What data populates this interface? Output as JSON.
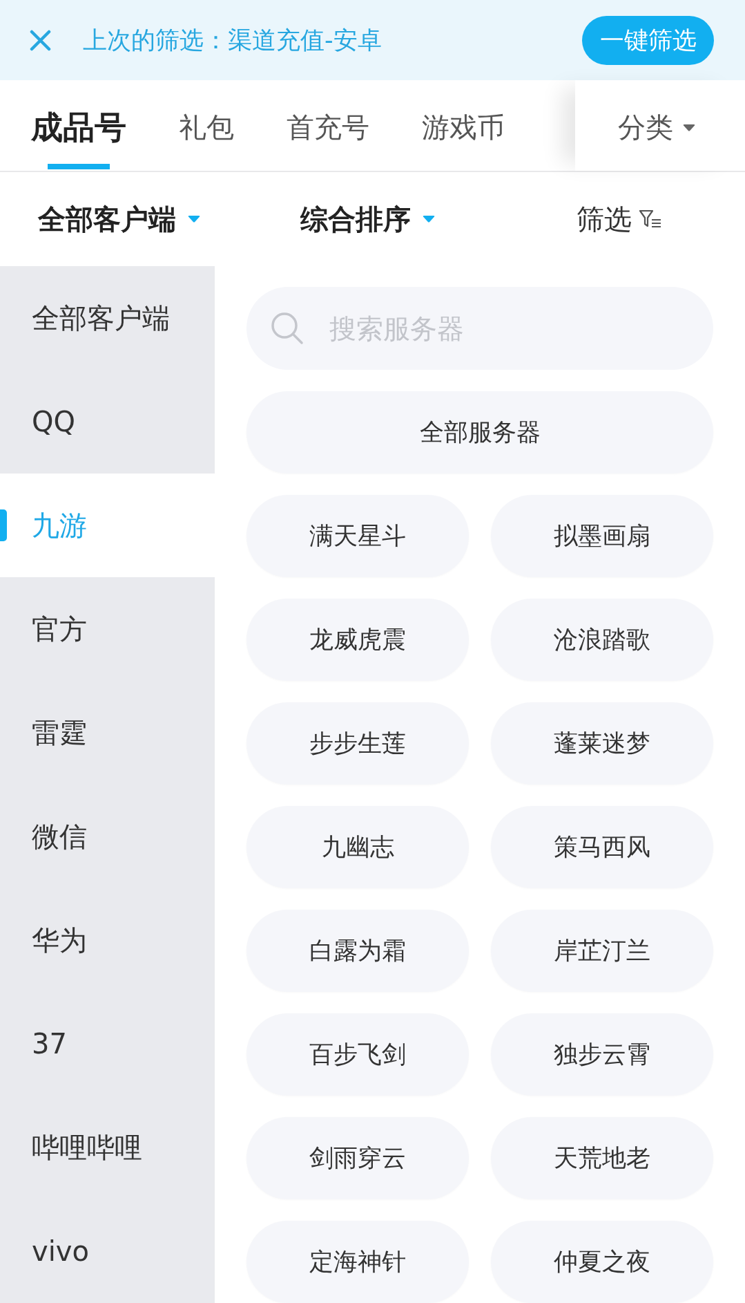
{
  "banner": {
    "text": "上次的筛选：渠道充值-安卓",
    "button": "一键筛选"
  },
  "tabs": [
    {
      "label": "成品号",
      "selected": true
    },
    {
      "label": "礼包",
      "selected": false
    },
    {
      "label": "首充号",
      "selected": false
    },
    {
      "label": "游戏币",
      "selected": false
    }
  ],
  "category_menu": {
    "label": "分类"
  },
  "filters": [
    {
      "kind": "dropdown",
      "label": "全部客户端"
    },
    {
      "kind": "dropdown",
      "label": "综合排序"
    },
    {
      "kind": "filter",
      "label": "筛选"
    }
  ],
  "sidebar": {
    "items": [
      {
        "label": "全部客户端",
        "selected": false
      },
      {
        "label": "QQ",
        "selected": false
      },
      {
        "label": "九游",
        "selected": true
      },
      {
        "label": "官方",
        "selected": false
      },
      {
        "label": "雷霆",
        "selected": false
      },
      {
        "label": "微信",
        "selected": false
      },
      {
        "label": "华为",
        "selected": false
      },
      {
        "label": "37",
        "selected": false
      },
      {
        "label": "哔哩哔哩",
        "selected": false
      },
      {
        "label": "vivo",
        "selected": false
      }
    ]
  },
  "search": {
    "placeholder": "搜索服务器"
  },
  "servers": {
    "all": "全部服务器",
    "items": [
      "满天星斗",
      "拟墨画扇",
      "龙威虎震",
      "沧浪踏歌",
      "步步生莲",
      "蓬莱迷梦",
      "九幽志",
      "策马西风",
      "白露为霜",
      "岸芷汀兰",
      "百步飞剑",
      "独步云霄",
      "剑雨穿云",
      "天荒地老",
      "定海神针",
      "仲夏之夜"
    ]
  }
}
